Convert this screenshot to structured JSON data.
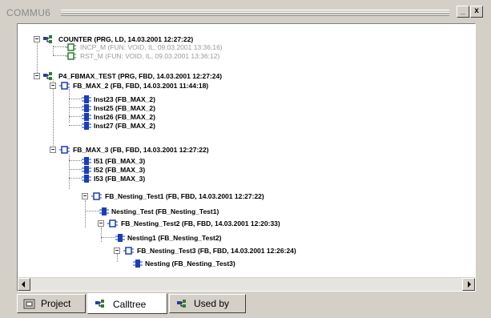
{
  "window": {
    "title": "COMMU6",
    "minimize_label": "_",
    "close_label": "x"
  },
  "tree": {
    "nodes": [
      {
        "label": "COUNTER (PRG, LD, 14.03.2001 12:27:22)",
        "icon": "calltree-icon",
        "dim": false
      },
      {
        "label": "INCP_M (FUN: VOID, IL, 09.03.2001 13:36:16)",
        "icon": "function-icon",
        "dim": true
      },
      {
        "label": "RST_M (FUN: VOID, IL, 09.03.2001 13:36:12)",
        "icon": "function-icon",
        "dim": true
      },
      {
        "label": "P4_FBMAX_TEST (PRG, FBD, 14.03.2001 12:27:24)",
        "icon": "calltree-icon",
        "dim": false
      },
      {
        "label": "FB_MAX_2 (FB, FBD, 14.03.2001 11:44:18)",
        "icon": "function-block-icon",
        "dim": false
      },
      {
        "label": "Inst23 (FB_MAX_2)",
        "icon": "instance-icon",
        "dim": false
      },
      {
        "label": "Inst25 (FB_MAX_2)",
        "icon": "instance-icon",
        "dim": false
      },
      {
        "label": "Inst26 (FB_MAX_2)",
        "icon": "instance-icon",
        "dim": false
      },
      {
        "label": "Inst27 (FB_MAX_2)",
        "icon": "instance-icon",
        "dim": false
      },
      {
        "label": "FB_MAX_3 (FB, FBD, 14.03.2001 12:27:22)",
        "icon": "function-block-icon",
        "dim": false
      },
      {
        "label": "I51 (FB_MAX_3)",
        "icon": "instance-icon",
        "dim": false
      },
      {
        "label": "I52 (FB_MAX_3)",
        "icon": "instance-icon",
        "dim": false
      },
      {
        "label": "I53 (FB_MAX_3)",
        "icon": "instance-icon",
        "dim": false
      },
      {
        "label": "FB_Nesting_Test1 (FB, FBD, 14.03.2001 12:27:22)",
        "icon": "function-block-icon",
        "dim": false
      },
      {
        "label": "Nesting_Test (FB_Nesting_Test1)",
        "icon": "instance-icon",
        "dim": false
      },
      {
        "label": "FB_Nesting_Test2 (FB, FBD, 14.03.2001 12:20:33)",
        "icon": "function-block-icon",
        "dim": false
      },
      {
        "label": "Nesting1 (FB_Nesting_Test2)",
        "icon": "instance-icon",
        "dim": false
      },
      {
        "label": "FB_Nesting_Test3 (FB, FBD, 14.03.2001 12:26:24)",
        "icon": "function-block-icon",
        "dim": false
      },
      {
        "label": "Nesting (FB_Nesting_Test3)",
        "icon": "instance-icon",
        "dim": false
      }
    ]
  },
  "tabs": [
    {
      "label": "Project",
      "icon": "project-icon",
      "active": false
    },
    {
      "label": "Calltree",
      "icon": "calltree-icon",
      "active": true
    },
    {
      "label": "Used by",
      "icon": "calltree-icon",
      "active": false
    }
  ],
  "colors": {
    "panel": "#d4d0c8",
    "instance_icon": "#1a3fb5",
    "calltree_icon": "#2e7d32",
    "dim_text": "#9a9a9a"
  }
}
